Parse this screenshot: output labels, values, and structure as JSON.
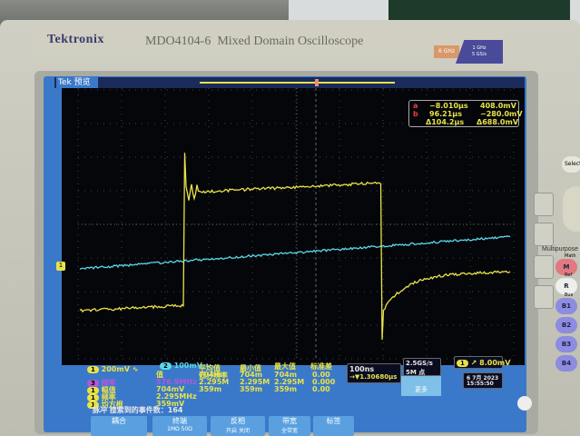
{
  "brand": {
    "logo": "Tektronix",
    "model": "MDO4104-6",
    "subtitle": "Mixed Domain Oscilloscope",
    "bw_rf": "6 GHz",
    "bw_analog": "1 GHz",
    "sample_rate_badge": "5 GS/s"
  },
  "screen": {
    "tek_label": "Tek",
    "mode": "预览"
  },
  "cursors": {
    "a_label": "a",
    "b_label": "b",
    "a_time": "−8.010μs",
    "a_volt": "408.0mV",
    "b_time": "96.21μs",
    "b_volt": "−280.0mV",
    "delta_time": "Δ104.2μs",
    "delta_volt": "Δ688.0mV"
  },
  "channels": {
    "ch1": {
      "num": "1",
      "scale": "200mV",
      "coupling": "∿",
      "color": "#e8e24a"
    },
    "ch2": {
      "num": "2",
      "scale": "100mV",
      "coupling": "∿",
      "color": "#5ad8e8"
    }
  },
  "measurements": {
    "headers": [
      "值",
      "平均值",
      "最小值",
      "最大值",
      "标准差"
    ],
    "subheader": "低分辨率",
    "rows": [
      {
        "src": "3",
        "name": "频率",
        "value": "576.9MHz",
        "mean": "704m",
        "min": "704m",
        "max": "704m",
        "std": "0.00"
      },
      {
        "src": "1",
        "name": "幅值",
        "value": "704mV",
        "mean": "2.295M",
        "min": "2.295M",
        "max": "2.295M",
        "std": "0.000"
      },
      {
        "src": "1",
        "name": "频率",
        "value": "2.295MHz",
        "mean": "359m",
        "min": "359m",
        "max": "359m",
        "std": "0.00"
      },
      {
        "src": "1",
        "name": "均方根",
        "value": "359mV",
        "mean": "",
        "min": "",
        "max": "",
        "std": ""
      }
    ],
    "event_text": "脉冲 搜索到的事件数：164"
  },
  "timebase": {
    "scale": "100ns",
    "delay": "→▼1.30680μs",
    "rate": "2.5GS/s",
    "record": "5M 点"
  },
  "trigger": {
    "src": "1",
    "slope": "↗",
    "level": "8.00mV"
  },
  "datetime": {
    "date": "6 7月 2023",
    "time": "15:55:50"
  },
  "bottom_menu": [
    {
      "title": "耦合",
      "value": ""
    },
    {
      "title": "终端",
      "value": "1MΩ   50Ω"
    },
    {
      "title": "反相",
      "value": "开启  关闭"
    },
    {
      "title": "带宽",
      "value": "全带宽"
    },
    {
      "title": "标签",
      "value": ""
    }
  ],
  "more_label": "更多",
  "front_panel": {
    "select": "Select",
    "multipurpose": "Multipurpose",
    "math": "M",
    "math_label": "Math",
    "ref": "R",
    "ref_label": "Ref",
    "bus_label": "Bus",
    "bus": [
      "B1",
      "B2",
      "B3",
      "B4"
    ]
  }
}
